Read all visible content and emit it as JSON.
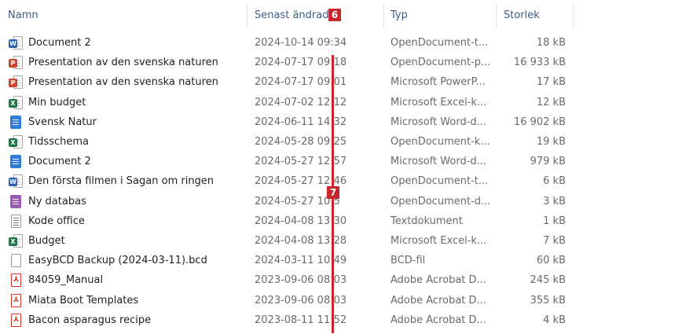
{
  "columns": {
    "name": "Namn",
    "date": "Senast ändrad",
    "type": "Typ",
    "size": "Storlek"
  },
  "annotations": {
    "marker_a": "6",
    "marker_b": "7",
    "color": "#c8262c"
  },
  "files": [
    {
      "icon": "word-odt",
      "name": "Document 2",
      "date": "2024-10-14 09:34",
      "type": "OpenDocument-t...",
      "size": "18 kB"
    },
    {
      "icon": "powerpoint",
      "name": "Presentation av den svenska naturen",
      "date": "2024-07-17 09:18",
      "type": "OpenDocument-p...",
      "size": "16 933 kB"
    },
    {
      "icon": "powerpoint",
      "name": "Presentation av den svenska naturen",
      "date": "2024-07-17 09:01",
      "type": "Microsoft PowerP...",
      "size": "17 kB"
    },
    {
      "icon": "excel",
      "name": "Min budget",
      "date": "2024-07-02 12:12",
      "type": "Microsoft Excel-k...",
      "size": "12 kB"
    },
    {
      "icon": "word-docx",
      "name": "Svensk Natur",
      "date": "2024-06-11 14:32",
      "type": "Microsoft Word-d...",
      "size": "16 902 kB"
    },
    {
      "icon": "excel",
      "name": "Tidsschema",
      "date": "2024-05-28 09:25",
      "type": "OpenDocument-k...",
      "size": "19 kB"
    },
    {
      "icon": "word-docx",
      "name": "Document 2",
      "date": "2024-05-27 12:57",
      "type": "Microsoft Word-d...",
      "size": "979 kB"
    },
    {
      "icon": "word-odt",
      "name": "Den första filmen i Sagan om ringen",
      "date": "2024-05-27 12:46",
      "type": "OpenDocument-t...",
      "size": "6 kB"
    },
    {
      "icon": "database",
      "name": "Ny databas",
      "date": "2024-05-27 10:5",
      "type": "OpenDocument-d...",
      "size": "3 kB"
    },
    {
      "icon": "text",
      "name": "Kode office",
      "date": "2024-04-08 13:30",
      "type": "Textdokument",
      "size": "1 kB"
    },
    {
      "icon": "excel",
      "name": "Budget",
      "date": "2024-04-08 13:28",
      "type": "Microsoft Excel-k...",
      "size": "7 kB"
    },
    {
      "icon": "blank",
      "name": "EasyBCD Backup (2024-03-11).bcd",
      "date": "2024-03-11 10:49",
      "type": "BCD-fil",
      "size": "60 kB"
    },
    {
      "icon": "pdf",
      "name": "84059_Manual",
      "date": "2023-09-06 08:03",
      "type": "Adobe Acrobat D...",
      "size": "245 kB"
    },
    {
      "icon": "pdf",
      "name": "Miata Boot Templates",
      "date": "2023-09-06 08:03",
      "type": "Adobe Acrobat D...",
      "size": "355 kB"
    },
    {
      "icon": "pdf",
      "name": "Bacon asparagus recipe",
      "date": "2023-08-11 11:52",
      "type": "Adobe Acrobat D...",
      "size": "4 kB"
    }
  ]
}
